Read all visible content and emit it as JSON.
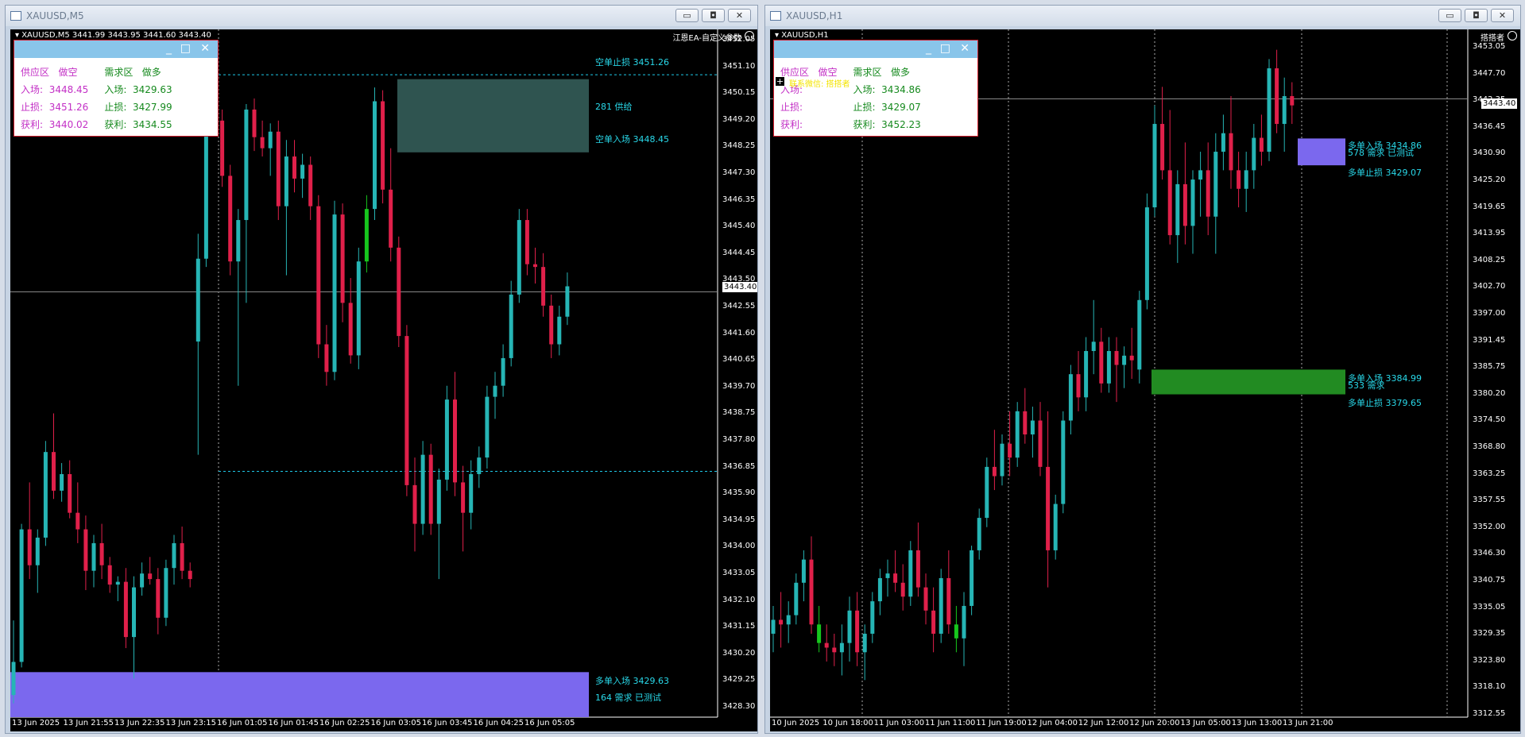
{
  "colors": {
    "bull": "#26b5b5",
    "bear": "#e0204a",
    "doji": "#f2e40a",
    "green": "#17c61d",
    "grid": "#808080"
  },
  "left": {
    "title": "XAUUSD,M5",
    "header": "XAUUSD,M5  3441.99 3443.95 3441.60 3443.40",
    "ea": "江恩EA-自定义参数",
    "panel": {
      "supply": "供应区",
      "short": "做空",
      "demand": "需求区",
      "long": "做多",
      "entry": "入场:",
      "stop": "止损:",
      "target": "获利:",
      "s_entry": "3448.45",
      "s_stop": "3451.26",
      "s_target": "3440.02",
      "d_entry": "3429.63",
      "d_stop": "3427.99",
      "d_target": "3434.55"
    },
    "labels": {
      "short_stop": "空单止损 3451.26",
      "supply_count": "281 供给",
      "short_entry": "空单入场 3448.45",
      "long_entry": "多单入场 3429.63",
      "demand_count": "164 需求 已测试"
    },
    "current_price": "3443.40",
    "prices": [
      "3452.05",
      "3451.10",
      "3450.15",
      "3449.20",
      "3448.25",
      "3447.30",
      "3446.35",
      "3445.40",
      "3444.45",
      "3443.50",
      "3442.55",
      "3441.60",
      "3440.65",
      "3439.70",
      "3438.75",
      "3437.80",
      "3436.85",
      "3435.90",
      "3434.95",
      "3434.00",
      "3433.05",
      "3432.10",
      "3431.15",
      "3430.20",
      "3429.25",
      "3428.30"
    ],
    "times": [
      "13 Jun 2025",
      "13 Jun 21:55",
      "13 Jun 22:35",
      "13 Jun 23:15",
      "16 Jun 01:05",
      "16 Jun 01:45",
      "16 Jun 02:25",
      "16 Jun 03:05",
      "16 Jun 03:45",
      "16 Jun 04:25",
      "16 Jun 05:05"
    ]
  },
  "right": {
    "title": "XAUUSD,H1",
    "header": "XAUUSD,H1",
    "ea": "搭搭者",
    "license": "联系微信: 搭搭者",
    "panel": {
      "supply": "供应区",
      "short": "做空",
      "demand": "需求区",
      "long": "做多",
      "entry": "入场:",
      "stop": "止损:",
      "target": "获利:",
      "s_entry": "",
      "s_stop": "",
      "s_target": "",
      "d_entry": "3434.86",
      "d_stop": "3429.07",
      "d_target": "3452.23"
    },
    "labels": {
      "long_entry_1": "多单入场 3434.86",
      "demand_count_1": "578 需求 已测试",
      "long_stop_1": "多单止损 3429.07",
      "long_entry_2": "多单入场 3384.99",
      "demand_count_2": "533 需求",
      "long_stop_2": "多单止损 3379.65"
    },
    "current_price": "3443.40",
    "prices": [
      "3453.05",
      "3447.70",
      "3442.35",
      "3436.45",
      "3430.90",
      "3425.20",
      "3419.65",
      "3413.95",
      "3408.25",
      "3402.70",
      "3397.00",
      "3391.45",
      "3385.75",
      "3380.20",
      "3374.50",
      "3368.80",
      "3363.25",
      "3357.55",
      "3352.00",
      "3346.30",
      "3340.75",
      "3335.05",
      "3329.35",
      "3323.80",
      "3318.10",
      "3312.55"
    ],
    "times": [
      "10 Jun 2025",
      "10 Jun 18:00",
      "11 Jun 03:00",
      "11 Jun 11:00",
      "11 Jun 19:00",
      "12 Jun 04:00",
      "12 Jun 12:00",
      "12 Jun 20:00",
      "13 Jun 05:00",
      "13 Jun 13:00",
      "13 Jun 21:00"
    ]
  },
  "chart_data": [
    {
      "type": "candlestick",
      "symbol": "XAUUSD",
      "timeframe": "M5",
      "ylim": [
        3428.0,
        3452.5
      ],
      "candles": [
        [
          3428.8,
          3431.5,
          3428.5,
          3430.0
        ],
        [
          3430.0,
          3435.0,
          3429.8,
          3434.8
        ],
        [
          3434.8,
          3436.5,
          3433.0,
          3433.5
        ],
        [
          3433.5,
          3434.8,
          3432.5,
          3434.5
        ],
        [
          3434.5,
          3438.0,
          3434.2,
          3437.6
        ],
        [
          3437.6,
          3439.0,
          3435.9,
          3436.2
        ],
        [
          3436.2,
          3437.2,
          3435.8,
          3436.8
        ],
        [
          3436.8,
          3437.3,
          3435.2,
          3435.4
        ],
        [
          3435.4,
          3436.5,
          3434.3,
          3434.8
        ],
        [
          3434.8,
          3435.3,
          3432.6,
          3433.3
        ],
        [
          3433.3,
          3434.6,
          3432.7,
          3434.3
        ],
        [
          3434.3,
          3435.0,
          3433.0,
          3433.5
        ],
        [
          3433.5,
          3433.8,
          3432.5,
          3432.8
        ],
        [
          3432.8,
          3433.1,
          3432.2,
          3432.9
        ],
        [
          3432.9,
          3433.4,
          3430.5,
          3430.9
        ],
        [
          3430.9,
          3433.1,
          3429.4,
          3432.7
        ],
        [
          3432.7,
          3433.6,
          3432.4,
          3433.2
        ],
        [
          3433.2,
          3433.8,
          3432.8,
          3433.0
        ],
        [
          3433.0,
          3433.4,
          3431.0,
          3431.6
        ],
        [
          3431.6,
          3433.7,
          3431.3,
          3433.4
        ],
        [
          3433.4,
          3434.6,
          3432.8,
          3434.3
        ],
        [
          3434.3,
          3434.9,
          3433.0,
          3433.3
        ],
        [
          3433.3,
          3433.6,
          3432.7,
          3433.0
        ],
        [
          3441.6,
          3445.5,
          3437.5,
          3444.6
        ],
        [
          3444.6,
          3450.8,
          3444.3,
          3450.2
        ],
        [
          3450.2,
          3451.2,
          3449.1,
          3449.6
        ],
        [
          3449.6,
          3450.0,
          3447.2,
          3447.6
        ],
        [
          3447.6,
          3448.0,
          3444.0,
          3444.5
        ],
        [
          3444.5,
          3446.4,
          3440.0,
          3446.0
        ],
        [
          3446.0,
          3450.2,
          3443.0,
          3450.0
        ],
        [
          3450.0,
          3450.4,
          3448.5,
          3449.0
        ],
        [
          3449.0,
          3449.6,
          3448.3,
          3448.6
        ],
        [
          3448.6,
          3449.5,
          3447.6,
          3449.2
        ],
        [
          3449.2,
          3449.6,
          3446.0,
          3446.5
        ],
        [
          3446.5,
          3448.9,
          3444.0,
          3448.3
        ],
        [
          3448.3,
          3448.9,
          3447.0,
          3447.5
        ],
        [
          3447.5,
          3448.4,
          3446.8,
          3448.0
        ],
        [
          3448.0,
          3448.3,
          3446.0,
          3446.5
        ],
        [
          3446.5,
          3446.9,
          3441.0,
          3441.5
        ],
        [
          3441.5,
          3442.2,
          3440.0,
          3440.5
        ],
        [
          3440.5,
          3446.7,
          3440.2,
          3446.2
        ],
        [
          3446.2,
          3446.6,
          3442.3,
          3443.0
        ],
        [
          3443.0,
          3443.9,
          3440.8,
          3441.1
        ],
        [
          3441.1,
          3445.0,
          3440.6,
          3444.5
        ],
        [
          3444.5,
          3446.9,
          3444.1,
          3446.4
        ],
        [
          3446.4,
          3450.8,
          3446.0,
          3450.3
        ],
        [
          3450.3,
          3450.7,
          3446.6,
          3447.1
        ],
        [
          3447.1,
          3448.6,
          3444.5,
          3445.0
        ],
        [
          3445.0,
          3445.4,
          3441.4,
          3441.8
        ],
        [
          3441.8,
          3442.2,
          3436.0,
          3436.4
        ],
        [
          3436.4,
          3437.4,
          3434.0,
          3435.0
        ],
        [
          3435.0,
          3438.0,
          3434.6,
          3437.5
        ],
        [
          3437.5,
          3437.9,
          3434.6,
          3435.0
        ],
        [
          3435.0,
          3437.0,
          3433.0,
          3436.6
        ],
        [
          3436.6,
          3440.0,
          3436.2,
          3439.5
        ],
        [
          3439.5,
          3440.5,
          3436.0,
          3436.5
        ],
        [
          3436.5,
          3437.1,
          3434.0,
          3435.4
        ],
        [
          3435.4,
          3437.3,
          3434.8,
          3436.8
        ],
        [
          3436.8,
          3437.8,
          3436.3,
          3437.4
        ],
        [
          3437.4,
          3440.0,
          3437.0,
          3439.6
        ],
        [
          3439.6,
          3440.5,
          3438.8,
          3440.0
        ],
        [
          3440.0,
          3441.5,
          3439.6,
          3441.0
        ],
        [
          3441.0,
          3443.8,
          3440.7,
          3443.3
        ],
        [
          3443.3,
          3446.4,
          3443.0,
          3446.0
        ],
        [
          3446.0,
          3446.4,
          3444.0,
          3444.4
        ],
        [
          3444.4,
          3445.0,
          3443.7,
          3444.3
        ],
        [
          3444.3,
          3444.8,
          3442.5,
          3442.9
        ],
        [
          3442.9,
          3443.3,
          3441.0,
          3441.5
        ],
        [
          3441.5,
          3442.9,
          3441.1,
          3442.5
        ],
        [
          3442.5,
          3444.1,
          3442.2,
          3443.6
        ]
      ]
    },
    {
      "type": "candlestick",
      "symbol": "XAUUSD",
      "timeframe": "H1",
      "ylim": [
        3310.0,
        3456.0
      ],
      "candles": [
        [
          3328,
          3334,
          3324,
          3331
        ],
        [
          3331,
          3337,
          3325,
          3330
        ],
        [
          3330,
          3335,
          3326,
          3332
        ],
        [
          3332,
          3341,
          3330,
          3339
        ],
        [
          3339,
          3346,
          3335,
          3344
        ],
        [
          3344,
          3349,
          3328,
          3330
        ],
        [
          3330,
          3334,
          3324,
          3326
        ],
        [
          3326,
          3330,
          3322,
          3325
        ],
        [
          3325,
          3328,
          3321,
          3324
        ],
        [
          3324,
          3330,
          3319,
          3326
        ],
        [
          3326,
          3336,
          3322,
          3333
        ],
        [
          3333,
          3337,
          3321,
          3324
        ],
        [
          3324,
          3330,
          3318,
          3328
        ],
        [
          3328,
          3337,
          3326,
          3335
        ],
        [
          3335,
          3342,
          3332,
          3340
        ],
        [
          3340,
          3344,
          3336,
          3341
        ],
        [
          3341,
          3346,
          3337,
          3339
        ],
        [
          3339,
          3343,
          3333,
          3336
        ],
        [
          3336,
          3348,
          3334,
          3346
        ],
        [
          3346,
          3352,
          3336,
          3338
        ],
        [
          3338,
          3341,
          3330,
          3333
        ],
        [
          3333,
          3338,
          3324,
          3328
        ],
        [
          3328,
          3342,
          3326,
          3340
        ],
        [
          3340,
          3346,
          3328,
          3330
        ],
        [
          3330,
          3334,
          3324,
          3327
        ],
        [
          3327,
          3337,
          3321,
          3334
        ],
        [
          3334,
          3347,
          3332,
          3346
        ],
        [
          3346,
          3355,
          3344,
          3353
        ],
        [
          3353,
          3366,
          3351,
          3364
        ],
        [
          3364,
          3372,
          3359,
          3362
        ],
        [
          3362,
          3371,
          3360,
          3369
        ],
        [
          3369,
          3376,
          3362,
          3366
        ],
        [
          3366,
          3378,
          3364,
          3376
        ],
        [
          3376,
          3381,
          3369,
          3371
        ],
        [
          3371,
          3377,
          3366,
          3374
        ],
        [
          3374,
          3378,
          3362,
          3364
        ],
        [
          3364,
          3376,
          3338,
          3346
        ],
        [
          3346,
          3358,
          3344,
          3356
        ],
        [
          3356,
          3376,
          3354,
          3374
        ],
        [
          3374,
          3386,
          3371,
          3384
        ],
        [
          3384,
          3389,
          3376,
          3379
        ],
        [
          3379,
          3392,
          3376,
          3389
        ],
        [
          3389,
          3400,
          3384,
          3391
        ],
        [
          3391,
          3394,
          3380,
          3382
        ],
        [
          3382,
          3392,
          3380,
          3389
        ],
        [
          3389,
          3392,
          3378,
          3386
        ],
        [
          3386,
          3390,
          3381,
          3388
        ],
        [
          3388,
          3394,
          3383,
          3387
        ],
        [
          3385,
          3402,
          3382,
          3400
        ],
        [
          3400,
          3423,
          3398,
          3420
        ],
        [
          3420,
          3442,
          3418,
          3438
        ],
        [
          3438,
          3446,
          3426,
          3428
        ],
        [
          3428,
          3441,
          3412,
          3414
        ],
        [
          3414,
          3428,
          3408,
          3425
        ],
        [
          3425,
          3434,
          3412,
          3416
        ],
        [
          3416,
          3428,
          3410,
          3426
        ],
        [
          3426,
          3432,
          3418,
          3428
        ],
        [
          3428,
          3434,
          3414,
          3418
        ],
        [
          3418,
          3436,
          3410,
          3432
        ],
        [
          3432,
          3440,
          3428,
          3436
        ],
        [
          3436,
          3444,
          3424,
          3428
        ],
        [
          3428,
          3432,
          3420,
          3424
        ],
        [
          3424,
          3432,
          3419,
          3428
        ],
        [
          3428,
          3438,
          3424,
          3435
        ],
        [
          3435,
          3440,
          3429,
          3432
        ],
        [
          3432,
          3452,
          3430,
          3450
        ],
        [
          3450,
          3454,
          3436,
          3438
        ],
        [
          3438,
          3448,
          3432,
          3444
        ],
        [
          3444,
          3447,
          3438,
          3442
        ]
      ]
    }
  ]
}
